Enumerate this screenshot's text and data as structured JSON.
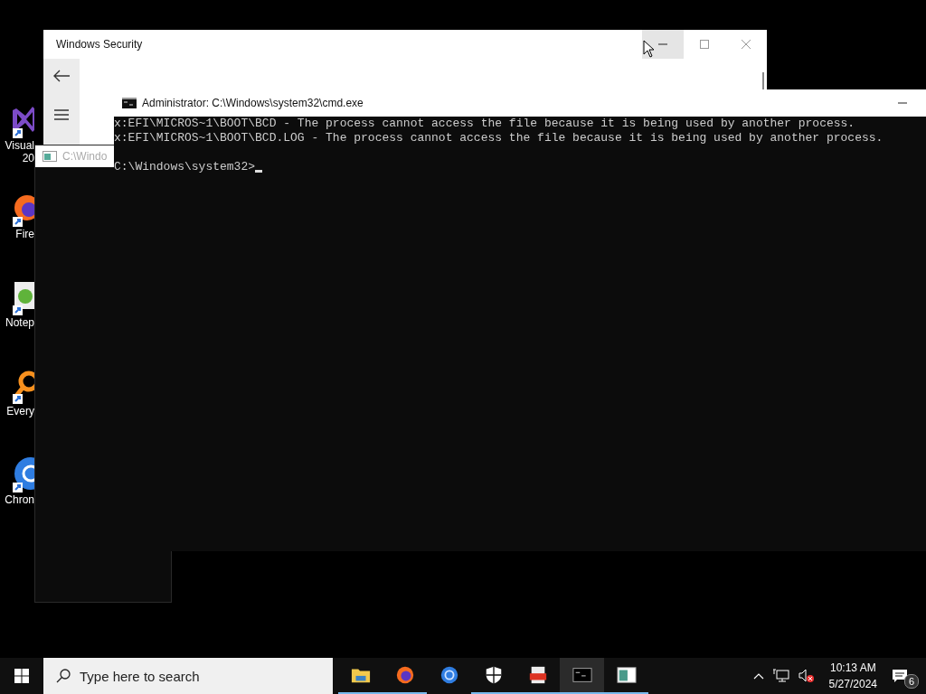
{
  "desktop_icons": [
    {
      "kind": "visual-studio",
      "label_lines": [
        "Visual",
        "20"
      ]
    },
    {
      "kind": "firefox",
      "label_lines": [
        "Fire"
      ]
    },
    {
      "kind": "notepad",
      "label_lines": [
        "Notep"
      ]
    },
    {
      "kind": "everything",
      "label_lines": [
        "Every"
      ]
    },
    {
      "kind": "chrome",
      "label_lines": [
        "Chron"
      ]
    }
  ],
  "security_window": {
    "title": "Windows Security",
    "controls": [
      {
        "kind": "minimize",
        "hovered": true
      },
      {
        "kind": "maximize",
        "hovered": false
      },
      {
        "kind": "close",
        "hovered": false
      }
    ]
  },
  "background_window": {
    "title": "C:\\Windo"
  },
  "cmd_window": {
    "title": "Administrator: C:\\Windows\\system32\\cmd.exe",
    "lines": [
      {
        "kind": "output",
        "text": "x:EFI\\MICROS~1\\BOOT\\BCD - The process cannot access the file because it is being used by another process."
      },
      {
        "kind": "output",
        "text": "x:EFI\\MICROS~1\\BOOT\\BCD.LOG - The process cannot access the file because it is being used by another process."
      },
      {
        "kind": "prompt",
        "text": "C:\\Windows\\system32>"
      }
    ],
    "cursor": true
  },
  "taskbar": {
    "search": {
      "placeholder": "Type here to search"
    },
    "apps": [
      {
        "kind": "folder",
        "running": true,
        "selected": false
      },
      {
        "kind": "firefox",
        "running": true,
        "selected": false
      },
      {
        "kind": "chrome",
        "running": false,
        "selected": false
      },
      {
        "kind": "shield",
        "running": true,
        "selected": false
      },
      {
        "kind": "pdf",
        "running": true,
        "selected": false
      },
      {
        "kind": "terminal",
        "running": true,
        "selected": true
      },
      {
        "kind": "window",
        "running": true,
        "selected": false
      }
    ],
    "clock": {
      "time": "10:13 AM",
      "date": "5/27/2024"
    },
    "volume_muted": true,
    "notifications": "6"
  }
}
